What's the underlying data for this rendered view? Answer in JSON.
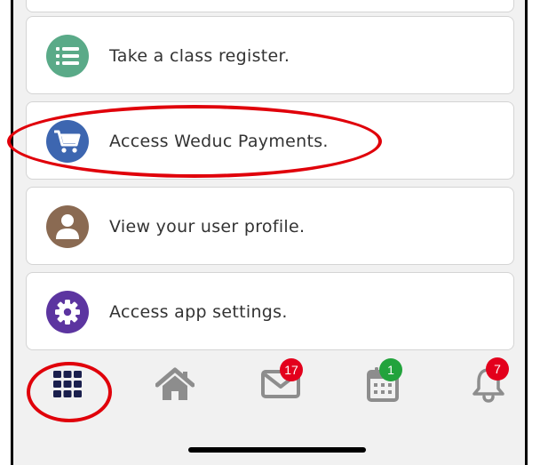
{
  "menu": {
    "items": [
      {
        "label": "Take a class register.",
        "icon": "list-icon",
        "color": "#5aaa88"
      },
      {
        "label": "Access Weduc Payments.",
        "icon": "shopping-cart-icon",
        "color": "#3d66b0"
      },
      {
        "label": "View your user profile.",
        "icon": "user-icon",
        "color": "#8a6a52"
      },
      {
        "label": "Access app settings.",
        "icon": "gear-icon",
        "color": "#5c35a0"
      }
    ]
  },
  "tabbar": {
    "tabs": [
      {
        "icon": "grid-icon",
        "badge": null
      },
      {
        "icon": "home-icon",
        "badge": null
      },
      {
        "icon": "mail-icon",
        "badge": "17"
      },
      {
        "icon": "calendar-icon",
        "badge": "1"
      },
      {
        "icon": "bell-icon",
        "badge": "7"
      }
    ]
  },
  "colors": {
    "grid_icon": "#1a1f4d",
    "inactive_icon": "#8d8d8d",
    "badge_red": "#e3001c",
    "badge_green": "#22a33c",
    "annotation_red": "#e0000a"
  }
}
